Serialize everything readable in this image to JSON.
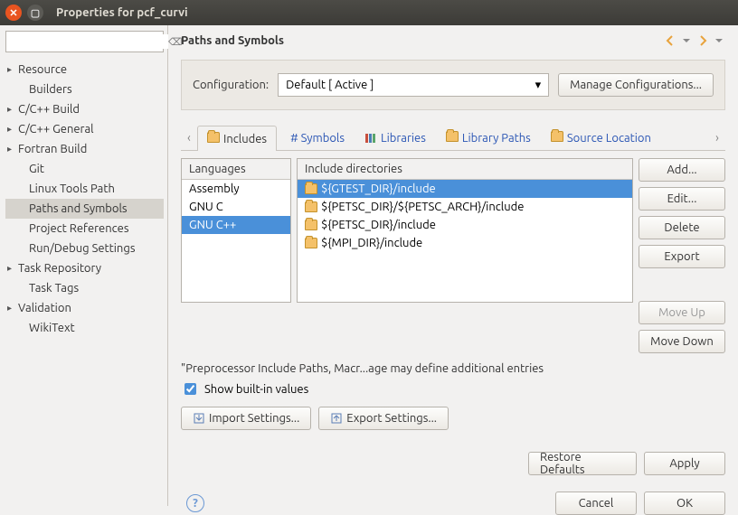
{
  "window": {
    "title": "Properties for pcf_curvi"
  },
  "sidebar": {
    "filter": {
      "value": ""
    },
    "items": [
      {
        "label": "Resource",
        "expandable": true,
        "expanded": false,
        "indent": 0,
        "selected": false
      },
      {
        "label": "Builders",
        "expandable": false,
        "indent": 1,
        "selected": false
      },
      {
        "label": "C/C++ Build",
        "expandable": true,
        "expanded": false,
        "indent": 0,
        "selected": false
      },
      {
        "label": "C/C++ General",
        "expandable": true,
        "expanded": false,
        "indent": 0,
        "selected": false
      },
      {
        "label": "Fortran Build",
        "expandable": true,
        "expanded": false,
        "indent": 0,
        "selected": false
      },
      {
        "label": "Git",
        "expandable": false,
        "indent": 1,
        "selected": false
      },
      {
        "label": "Linux Tools Path",
        "expandable": false,
        "indent": 1,
        "selected": false
      },
      {
        "label": "Paths and Symbols",
        "expandable": false,
        "indent": 1,
        "selected": true
      },
      {
        "label": "Project References",
        "expandable": false,
        "indent": 1,
        "selected": false
      },
      {
        "label": "Run/Debug Settings",
        "expandable": false,
        "indent": 1,
        "selected": false
      },
      {
        "label": "Task Repository",
        "expandable": true,
        "expanded": false,
        "indent": 0,
        "selected": false
      },
      {
        "label": "Task Tags",
        "expandable": false,
        "indent": 1,
        "selected": false
      },
      {
        "label": "Validation",
        "expandable": true,
        "expanded": false,
        "indent": 0,
        "selected": false
      },
      {
        "label": "WikiText",
        "expandable": false,
        "indent": 1,
        "selected": false
      }
    ]
  },
  "page": {
    "title": "Paths and Symbols",
    "config_label": "Configuration:",
    "config_value": "Default  [ Active ]",
    "manage_btn": "Manage Configurations...",
    "tabs": [
      {
        "label": "Includes",
        "active": true,
        "icon": "folder"
      },
      {
        "label": "# Symbols",
        "active": false,
        "icon": "hash"
      },
      {
        "label": "Libraries",
        "active": false,
        "icon": "books"
      },
      {
        "label": "Library Paths",
        "active": false,
        "icon": "folder"
      },
      {
        "label": "Source Location",
        "active": false,
        "icon": "folder"
      }
    ],
    "languages_header": "Languages",
    "languages": [
      {
        "label": "Assembly",
        "selected": false
      },
      {
        "label": "GNU C",
        "selected": false
      },
      {
        "label": "GNU C++",
        "selected": true
      }
    ],
    "includes_header": "Include directories",
    "includes": [
      {
        "label": "${GTEST_DIR}/include",
        "selected": true
      },
      {
        "label": "${PETSC_DIR}/${PETSC_ARCH}/include",
        "selected": false
      },
      {
        "label": "${PETSC_DIR}/include",
        "selected": false
      },
      {
        "label": "${MPI_DIR}/include",
        "selected": false
      }
    ],
    "actions": {
      "add": "Add...",
      "edit": "Edit...",
      "delete": "Delete",
      "export": "Export",
      "moveup": "Move Up",
      "movedown": "Move Down"
    },
    "note": "\"Preprocessor Include Paths, Macr...age may define additional entries",
    "show_builtin": "Show built-in values",
    "show_builtin_checked": true,
    "import_btn": "Import Settings...",
    "export_btn": "Export Settings...",
    "restore_btn": "Restore Defaults",
    "apply_btn": "Apply",
    "cancel_btn": "Cancel",
    "ok_btn": "OK"
  }
}
